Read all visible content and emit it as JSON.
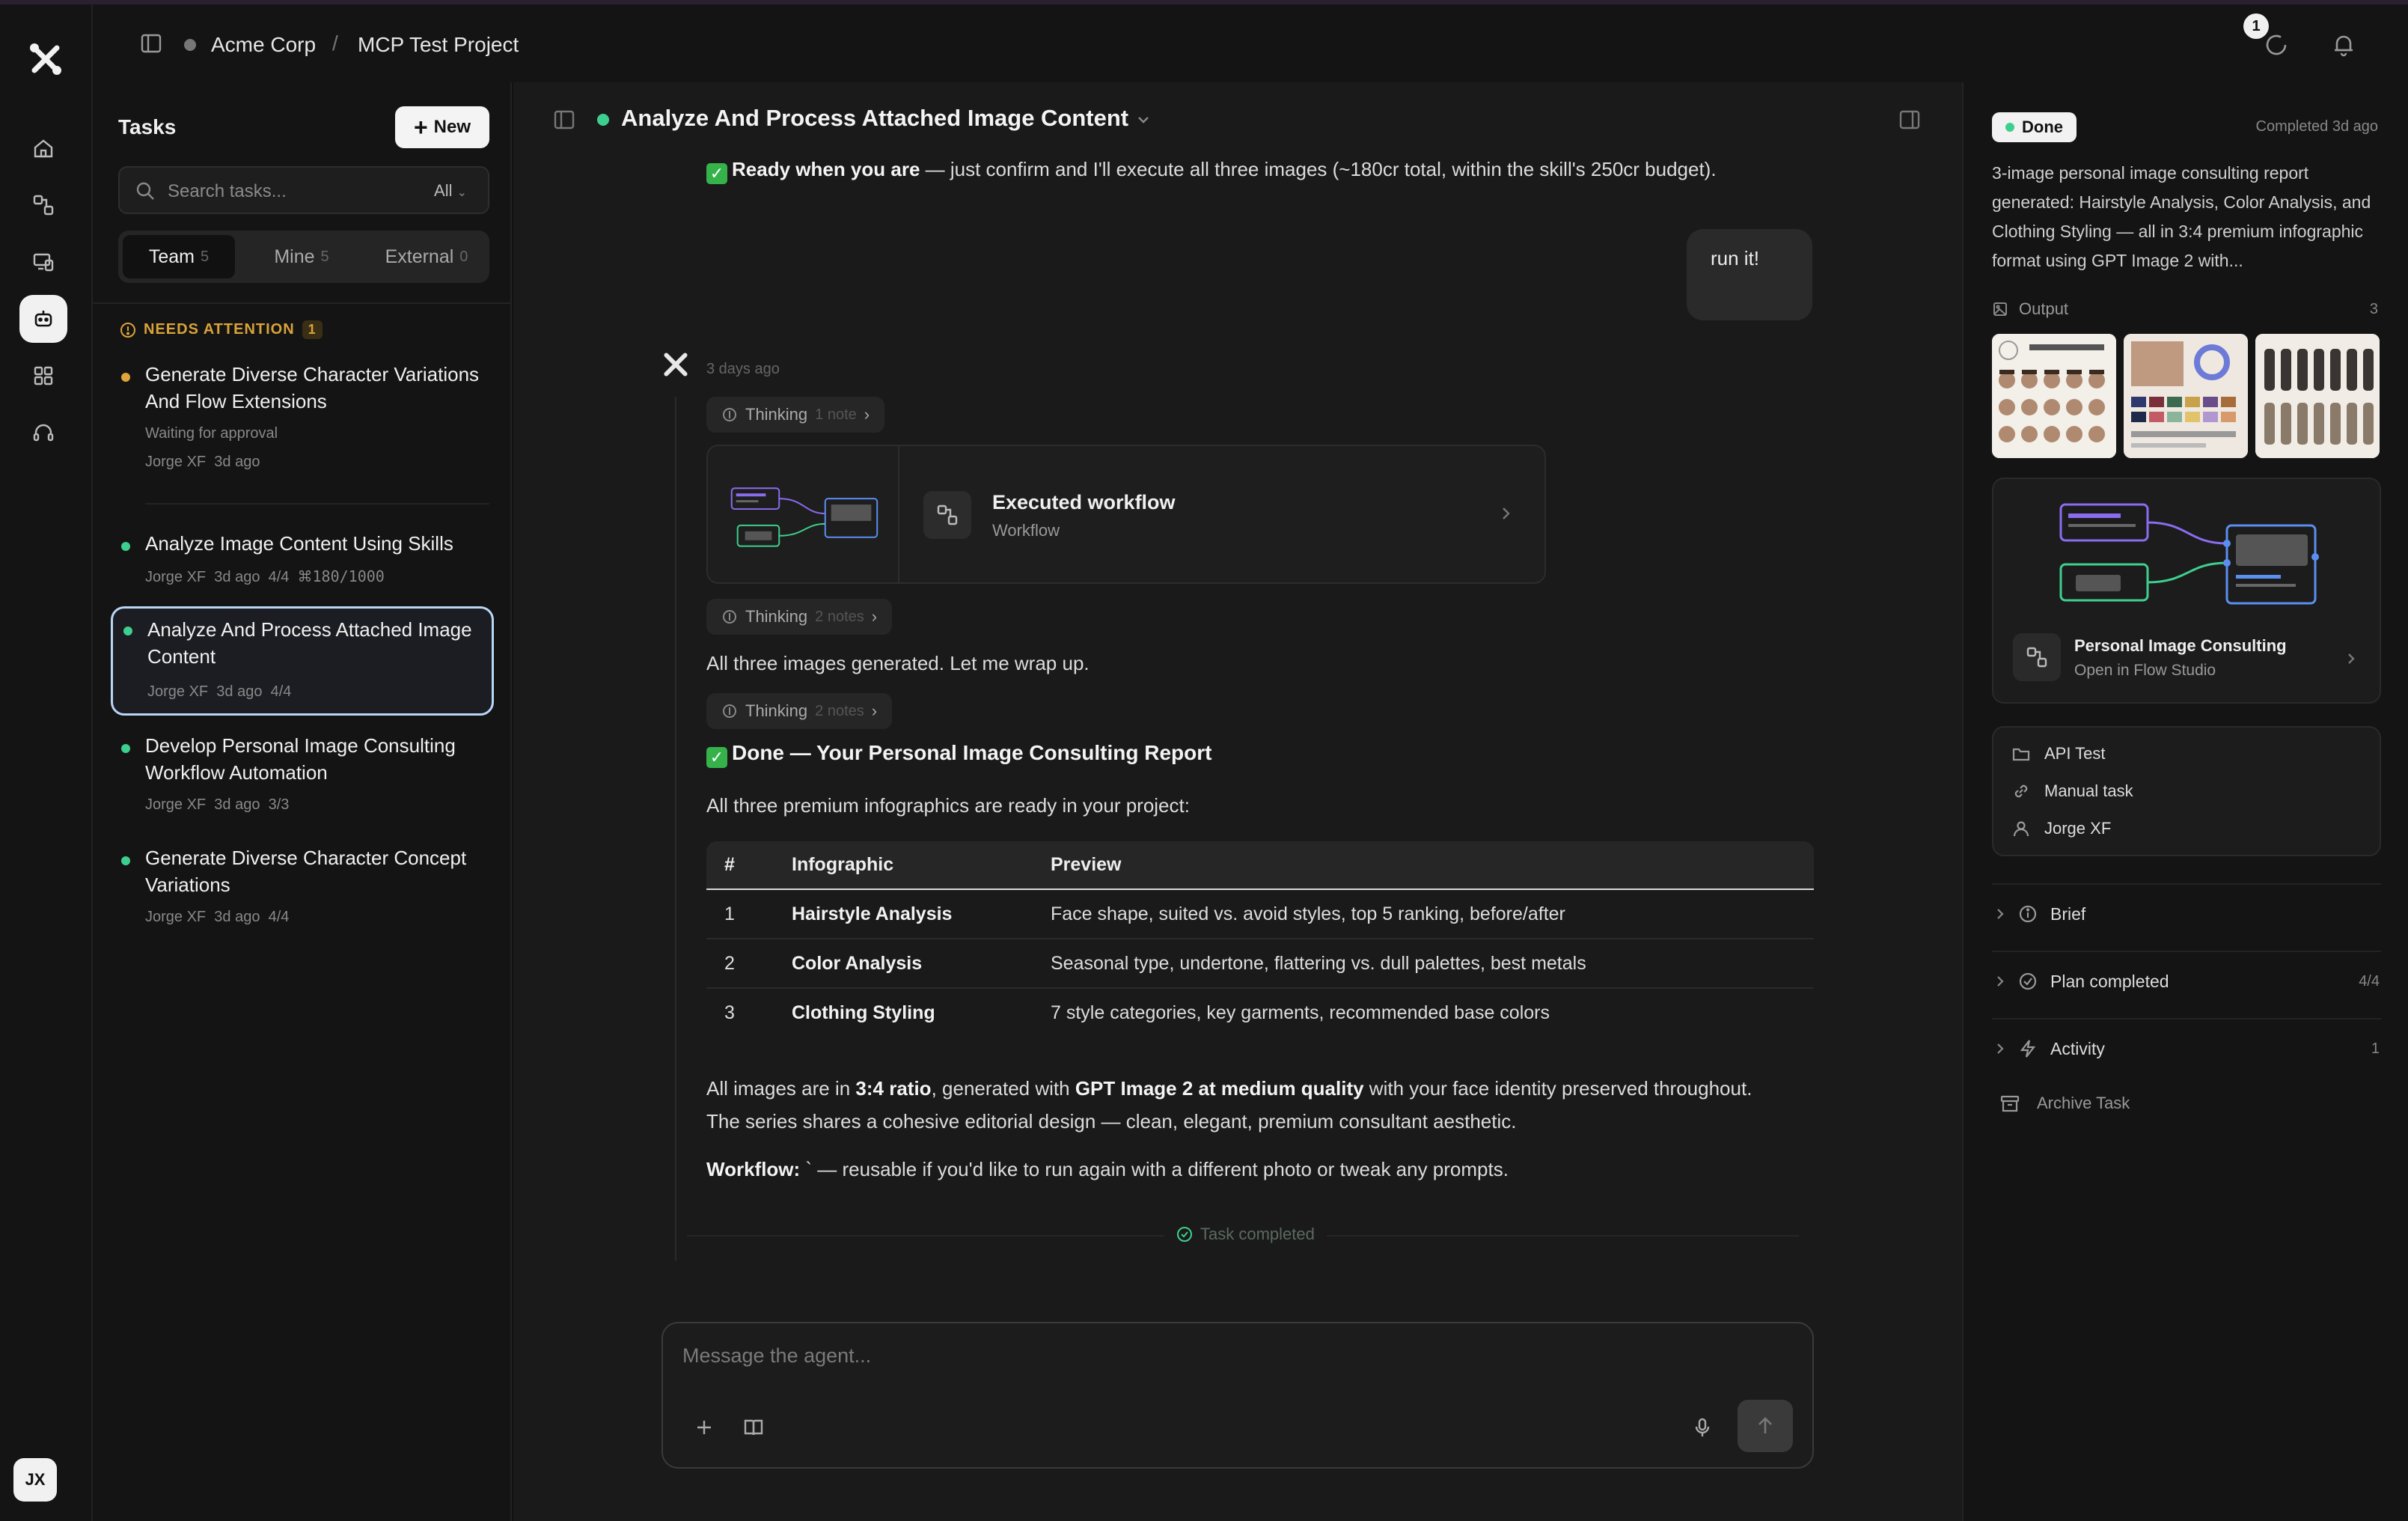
{
  "breadcrumb": {
    "org": "Acme Corp",
    "separator": "/",
    "project": "MCP Test Project"
  },
  "notifications": {
    "activity_count": "1"
  },
  "user": {
    "initials": "JX"
  },
  "tasks_panel": {
    "title": "Tasks",
    "new_label": "New",
    "search_placeholder": "Search tasks...",
    "filter": "All",
    "segments": [
      {
        "label": "Team",
        "count": "5"
      },
      {
        "label": "Mine",
        "count": "5"
      },
      {
        "label": "External",
        "count": "0"
      }
    ],
    "attention_label": "NEEDS ATTENTION",
    "attention_count": "1",
    "items": [
      {
        "title": "Generate Diverse Character Variations And Flow Extensions",
        "status_text": "Waiting for approval",
        "author": "Jorge XF",
        "time": "3d ago",
        "progress": "",
        "credits": "",
        "dot_color": "#e0a63a"
      },
      {
        "title": "Analyze Image Content Using Skills",
        "status_text": "",
        "author": "Jorge XF",
        "time": "3d ago",
        "progress": "4/4",
        "credits": "180/1000",
        "dot_color": "#3ecf8e"
      },
      {
        "title": "Analyze And Process Attached Image Content",
        "status_text": "",
        "author": "Jorge XF",
        "time": "3d ago",
        "progress": "4/4",
        "credits": "",
        "dot_color": "#3ecf8e"
      },
      {
        "title": "Develop Personal Image Consulting Workflow Automation",
        "status_text": "",
        "author": "Jorge XF",
        "time": "3d ago",
        "progress": "3/3",
        "credits": "",
        "dot_color": "#3ecf8e"
      },
      {
        "title": "Generate Diverse Character Concept Variations",
        "status_text": "",
        "author": "Jorge XF",
        "time": "3d ago",
        "progress": "4/4",
        "credits": "",
        "dot_color": "#3ecf8e"
      }
    ]
  },
  "chat": {
    "title": "Analyze And Process Attached Image Content",
    "ready_bold": "Ready when you are",
    "ready_rest": " — just confirm and I'll execute all three images (~180cr total, within the skill's 250cr budget).",
    "user_message": "run it!",
    "agent_time": "3 days ago",
    "thinking_label": "Thinking",
    "thinking_1_note": "1 note",
    "thinking_2_note": "2 notes",
    "thinking_3_note": "2 notes",
    "workflow_title": "Executed workflow",
    "workflow_sub": "Workflow",
    "wrap_up": "All three images generated. Let me wrap up.",
    "done_heading": "Done — Your Personal Image Consulting Report",
    "ready_intro": "All three premium infographics are ready in your project:",
    "table": {
      "headers": [
        "#",
        "Infographic",
        "Preview"
      ],
      "rows": [
        [
          "1",
          "Hairstyle Analysis",
          "Face shape, suited vs. avoid styles, top 5 ranking, before/after"
        ],
        [
          "2",
          "Color Analysis",
          "Seasonal type, undertone, flattering vs. dull palettes, best metals"
        ],
        [
          "3",
          "Clothing Styling",
          "7 style categories, key garments, recommended base colors"
        ]
      ]
    },
    "summary_p1_a": "All images are in ",
    "summary_p1_b": "3:4 ratio",
    "summary_p1_c": ", generated with ",
    "summary_p1_d": "GPT Image 2 at medium quality",
    "summary_p1_e": " with your face identity preserved throughout.",
    "summary_p2": "The series shares a cohesive editorial design — clean, elegant, premium consultant aesthetic.",
    "workflow_label": "Workflow:",
    "workflow_tail": " ` — reusable if you'd like to run again with a different photo or tweak any prompts.",
    "task_completed": "Task completed",
    "composer_placeholder": "Message the agent..."
  },
  "details": {
    "status": "Done",
    "completed": "Completed 3d ago",
    "summary": "3-image personal image consulting report generated: Hairstyle Analysis, Color Analysis, and Clothing Styling — all in 3:4 premium infographic format using GPT Image 2 with...",
    "output_label": "Output",
    "output_count": "3",
    "flow_title": "Personal Image Consulting",
    "flow_sub": "Open in Flow Studio",
    "meta": {
      "project": "API Test",
      "trigger": "Manual task",
      "owner": "Jorge XF"
    },
    "sections": [
      {
        "label": "Brief",
        "count": ""
      },
      {
        "label": "Plan completed",
        "count": "4/4"
      },
      {
        "label": "Activity",
        "count": "1"
      }
    ],
    "archive_label": "Archive Task"
  },
  "colors": {
    "accent_green": "#3ecf8e",
    "attention": "#d9a33a",
    "selected_border": "#b9d6f4"
  }
}
